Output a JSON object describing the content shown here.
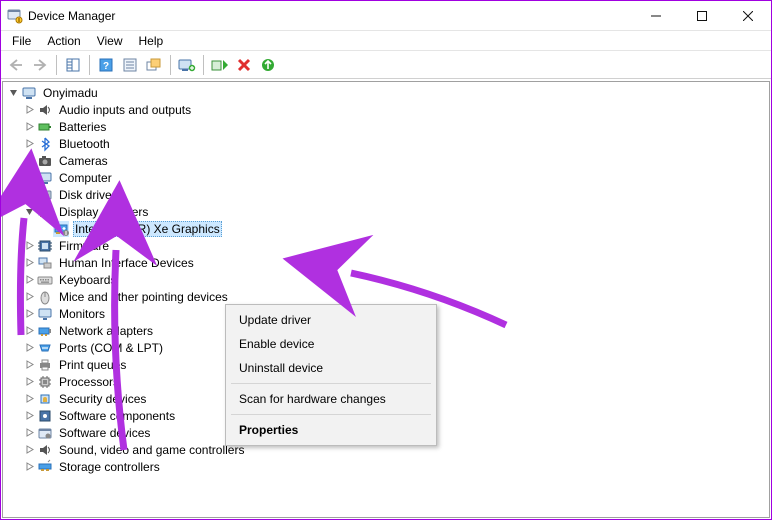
{
  "window": {
    "title": "Device Manager"
  },
  "menu": {
    "file": "File",
    "action": "Action",
    "view": "View",
    "help": "Help"
  },
  "tree": {
    "root": "Onyimadu",
    "items": [
      {
        "label": "Audio inputs and outputs"
      },
      {
        "label": "Batteries"
      },
      {
        "label": "Bluetooth"
      },
      {
        "label": "Cameras"
      },
      {
        "label": "Computer"
      },
      {
        "label": "Disk drives"
      },
      {
        "label": "Display adapters"
      },
      {
        "label": "Firmware"
      },
      {
        "label": "Human Interface Devices"
      },
      {
        "label": "Keyboards"
      },
      {
        "label": "Mice and other pointing devices"
      },
      {
        "label": "Monitors"
      },
      {
        "label": "Network adapters"
      },
      {
        "label": "Ports (COM & LPT)"
      },
      {
        "label": "Print queues"
      },
      {
        "label": "Processors"
      },
      {
        "label": "Security devices"
      },
      {
        "label": "Software components"
      },
      {
        "label": "Software devices"
      },
      {
        "label": "Sound, video and game controllers"
      },
      {
        "label": "Storage controllers"
      }
    ],
    "display_child": {
      "label": "Intel(R) Iris(R) Xe Graphics"
    }
  },
  "context_menu": {
    "update": "Update driver",
    "enable": "Enable device",
    "uninstall": "Uninstall device",
    "scan": "Scan for hardware changes",
    "properties": "Properties"
  }
}
